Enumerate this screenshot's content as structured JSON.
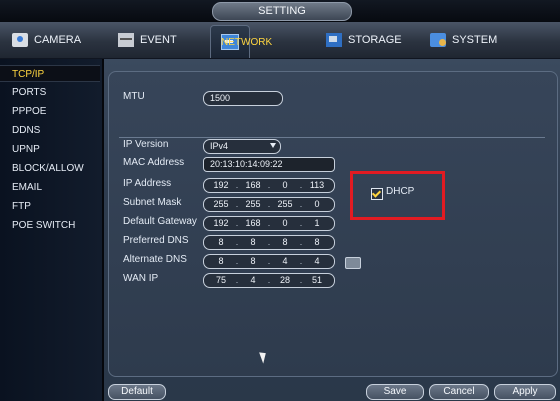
{
  "window": {
    "title": "SETTING"
  },
  "tabs": [
    {
      "label": "CAMERA",
      "icon": "camera-icon"
    },
    {
      "label": "EVENT",
      "icon": "event-icon"
    },
    {
      "label": "NETWORK",
      "icon": "network-icon",
      "active": true
    },
    {
      "label": "STORAGE",
      "icon": "storage-icon"
    },
    {
      "label": "SYSTEM",
      "icon": "system-icon"
    }
  ],
  "sidebar": {
    "items": [
      {
        "label": "TCP/IP",
        "active": true
      },
      {
        "label": "PORTS"
      },
      {
        "label": "PPPOE"
      },
      {
        "label": "DDNS"
      },
      {
        "label": "UPNP"
      },
      {
        "label": "BLOCK/ALLOW"
      },
      {
        "label": "EMAIL"
      },
      {
        "label": "FTP"
      },
      {
        "label": "POE SWITCH"
      }
    ]
  },
  "form": {
    "mtu": {
      "label": "MTU",
      "value": "1500"
    },
    "ip_version": {
      "label": "IP Version",
      "value": "IPv4"
    },
    "mac_address": {
      "label": "MAC Address",
      "value": "20:13:10:14:09:22"
    },
    "ip_address": {
      "label": "IP Address",
      "octets": [
        "192",
        "168",
        "0",
        "113"
      ]
    },
    "subnet_mask": {
      "label": "Subnet Mask",
      "octets": [
        "255",
        "255",
        "255",
        "0"
      ]
    },
    "default_gateway": {
      "label": "Default Gateway",
      "octets": [
        "192",
        "168",
        "0",
        "1"
      ]
    },
    "preferred_dns": {
      "label": "Preferred DNS",
      "octets": [
        "8",
        "8",
        "8",
        "8"
      ]
    },
    "alternate_dns": {
      "label": "Alternate DNS",
      "octets": [
        "8",
        "8",
        "4",
        "4"
      ]
    },
    "wan_ip": {
      "label": "WAN IP",
      "octets": [
        "75",
        "4",
        "28",
        "51"
      ]
    },
    "dhcp": {
      "label": "DHCP",
      "checked": true
    }
  },
  "buttons": {
    "default": "Default",
    "save": "Save",
    "cancel": "Cancel",
    "apply": "Apply"
  },
  "colors": {
    "accent": "#ffd640",
    "highlight_box": "#e21b22"
  }
}
